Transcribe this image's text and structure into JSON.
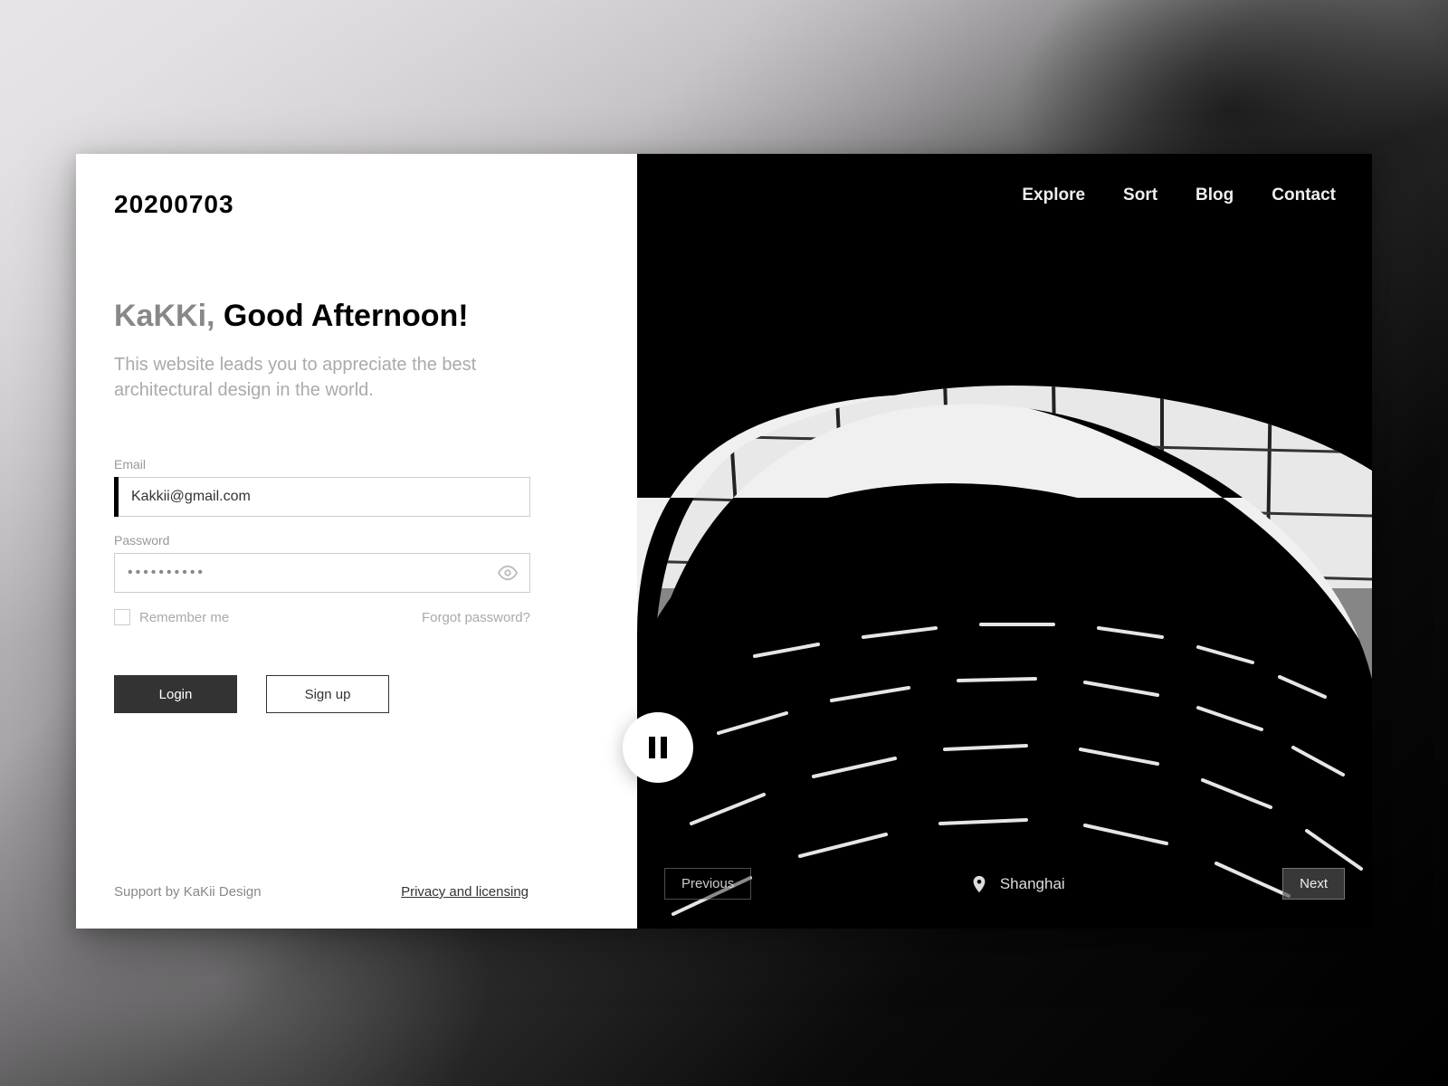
{
  "logo": "20200703",
  "greeting": {
    "name": "KaKKi,",
    "text": "Good Afternoon!"
  },
  "subtitle": "This website leads you to appreciate the best architectural design in the world.",
  "form": {
    "email_label": "Email",
    "email_value": "Kakkii@gmail.com",
    "password_label": "Password",
    "password_value": "••••••••••",
    "remember_label": "Remember me",
    "forgot_label": "Forgot password?"
  },
  "buttons": {
    "login": "Login",
    "signup": "Sign up"
  },
  "footer": {
    "support": "Support by KaKii Design",
    "privacy": "Privacy and licensing"
  },
  "nav": {
    "items": [
      "Explore",
      "Sort",
      "Blog",
      "Contact"
    ]
  },
  "slideshow": {
    "previous": "Previous",
    "next": "Next",
    "location": "Shanghai"
  }
}
